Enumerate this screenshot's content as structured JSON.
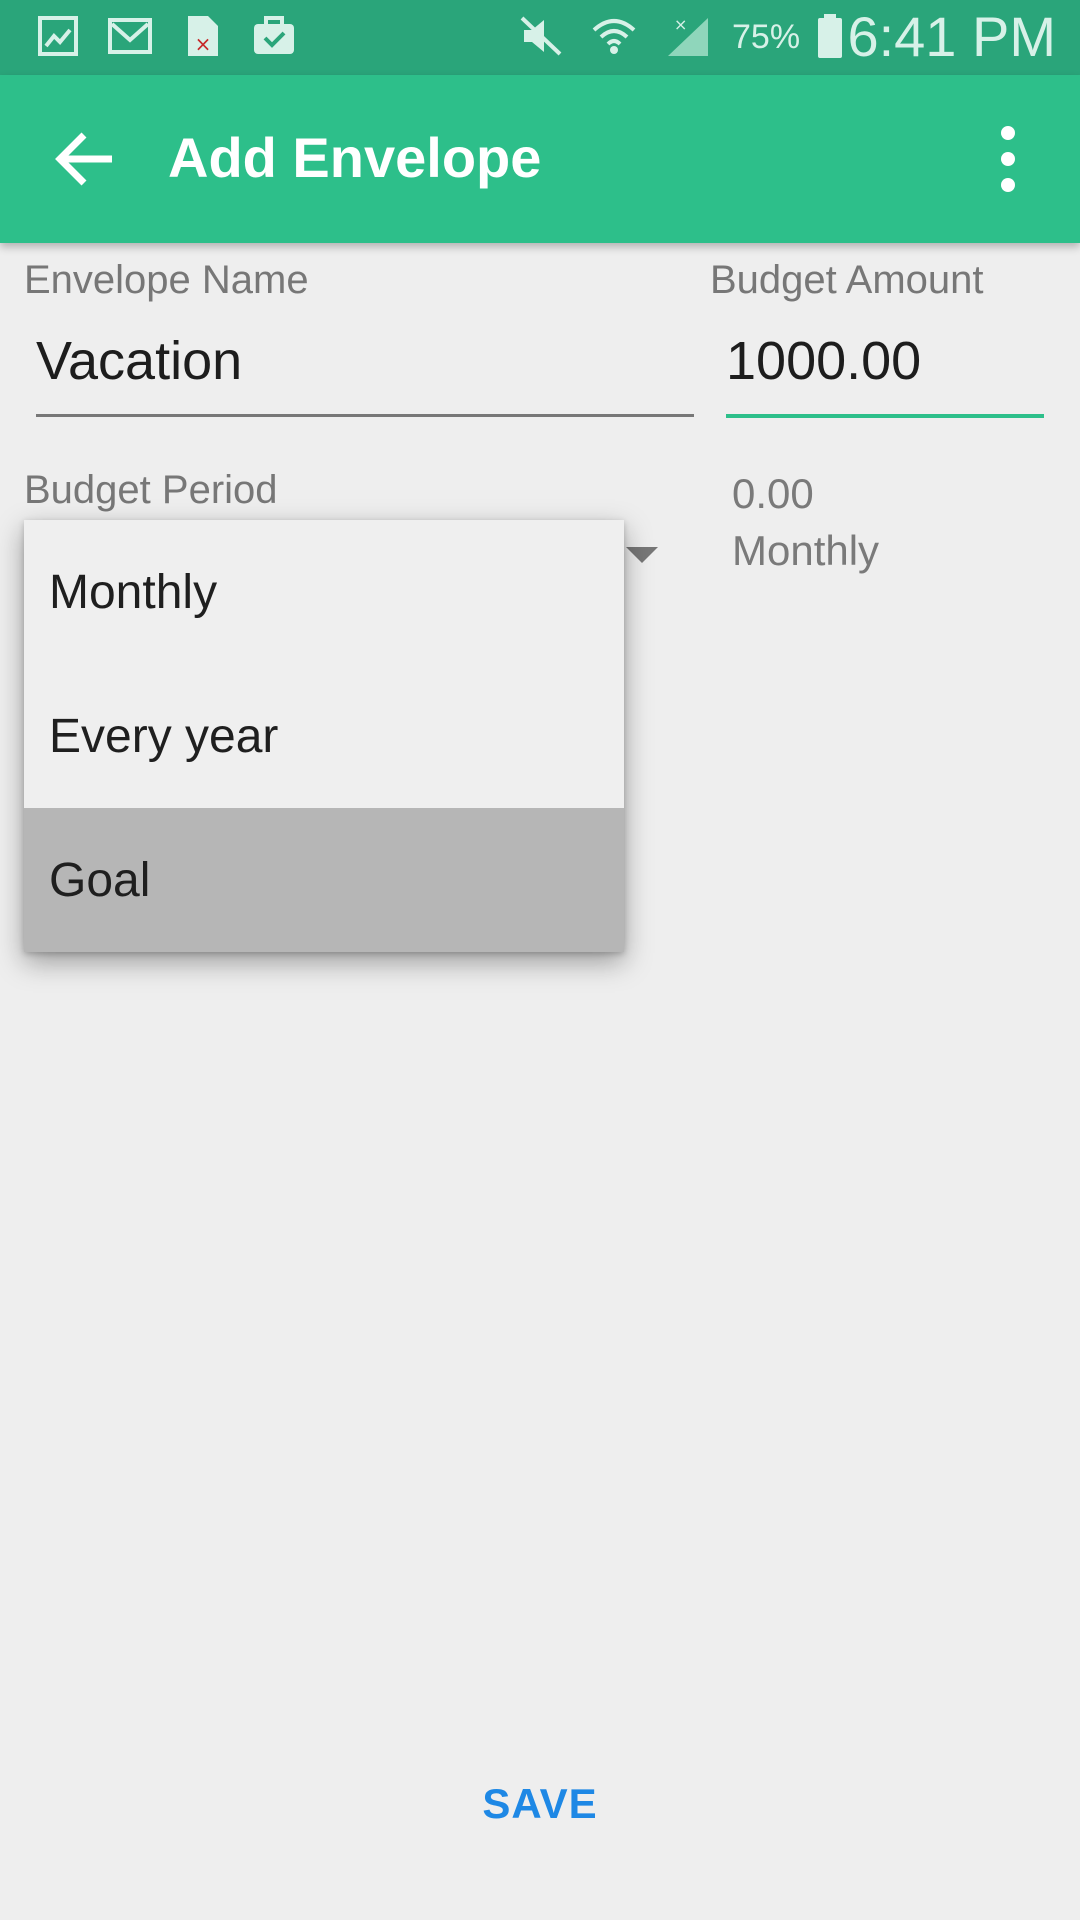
{
  "theme": {
    "primary": "#2dbf8a",
    "status_bar": "#2aa57a",
    "accent_blue": "#1e88e5",
    "background": "#eeeeee"
  },
  "status_bar": {
    "icons": [
      "gallery-icon",
      "gmail-icon",
      "document-error-icon",
      "briefcase-check-icon",
      "vibrate-muted-icon",
      "wifi-icon",
      "signal-icon",
      "battery-icon"
    ],
    "battery": "75%",
    "time": "6:41 PM"
  },
  "app_bar": {
    "title": "Add Envelope",
    "icons": {
      "back": "arrow-back-icon",
      "menu": "more-vert-icon"
    }
  },
  "form": {
    "envelope_name": {
      "label": "Envelope Name",
      "value": "Vacation"
    },
    "budget_amount": {
      "label": "Budget Amount",
      "value": "1000.00"
    },
    "budget_period": {
      "label": "Budget Period"
    },
    "summary": {
      "amount": "0.00",
      "period": "Monthly"
    }
  },
  "dropdown": {
    "options": [
      "Monthly",
      "Every year",
      "Goal"
    ],
    "highlighted": "Goal"
  },
  "save_label": "SAVE"
}
